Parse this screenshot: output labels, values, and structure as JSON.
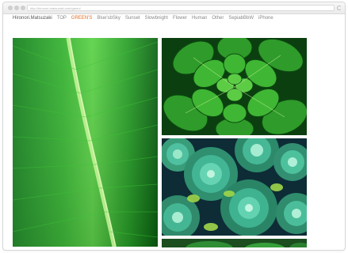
{
  "browser": {
    "url": "http://hironori-matsuzaki.com/green/"
  },
  "nav": {
    "brand": "Hironori.Matsuzaki",
    "items": [
      {
        "label": "TOP",
        "active": false
      },
      {
        "label": "GREEN'S",
        "active": true
      },
      {
        "label": "Blue'sbSky",
        "active": false
      },
      {
        "label": "Sunset",
        "active": false
      },
      {
        "label": "Slowbnight",
        "active": false
      },
      {
        "label": "Flower",
        "active": false
      },
      {
        "label": "Human",
        "active": false
      },
      {
        "label": "Other",
        "active": false
      },
      {
        "label": "SepiabBbW",
        "active": false
      },
      {
        "label": "iPhone",
        "active": false
      }
    ],
    "active_color": "#e06c1f"
  },
  "gallery": {
    "photos": [
      {
        "subject": "green-leaf"
      },
      {
        "subject": "green-plant-rosette"
      },
      {
        "subject": "teal-succulents"
      },
      {
        "subject": "succulent-partial"
      }
    ]
  }
}
